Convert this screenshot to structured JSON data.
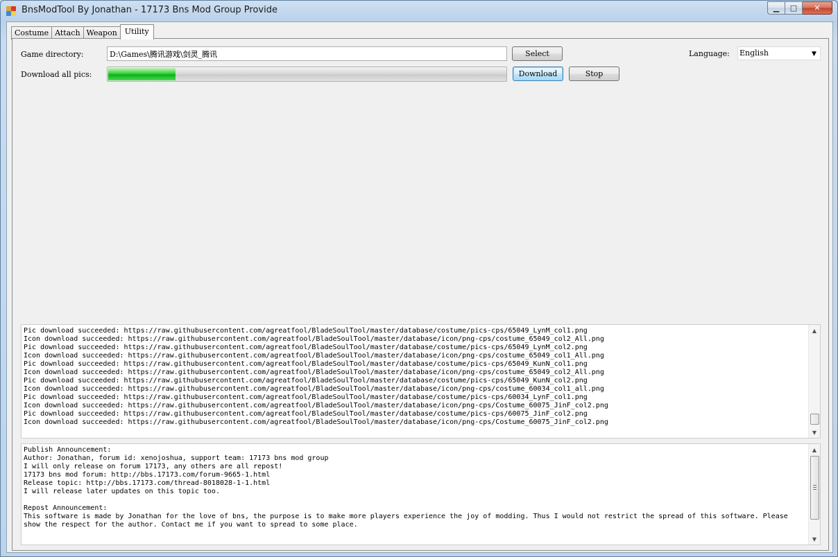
{
  "window": {
    "title": "BnsModTool By Jonathan - 17173 Bns Mod Group Provide",
    "min_glyph": "▁",
    "max_glyph": "□",
    "close_glyph": "✕"
  },
  "tabs": [
    {
      "label": "Costume",
      "active": false
    },
    {
      "label": "Attach",
      "active": false
    },
    {
      "label": "Weapon",
      "active": false
    },
    {
      "label": "Utility",
      "active": true
    }
  ],
  "utility": {
    "game_dir_label": "Game directory:",
    "game_dir_value": "D:\\Games\\腾讯游戏\\剑灵_腾讯",
    "select_button": "Select",
    "download_label": "Download all pics:",
    "progress_percent": 17,
    "download_button": "Download",
    "stop_button": "Stop",
    "language_label": "Language:",
    "language_value": "English",
    "dropdown_glyph": "▼"
  },
  "log": {
    "up_glyph": "▲",
    "down_glyph": "▼",
    "lines": [
      "Pic download succeeded: https://raw.githubusercontent.com/agreatfool/BladeSoulTool/master/database/costume/pics-cps/65049_LynM_col1.png",
      "Icon download succeeded: https://raw.githubusercontent.com/agreatfool/BladeSoulTool/master/database/icon/png-cps/costume_65049_col2_All.png",
      "Pic download succeeded: https://raw.githubusercontent.com/agreatfool/BladeSoulTool/master/database/costume/pics-cps/65049_LynM_col2.png",
      "Icon download succeeded: https://raw.githubusercontent.com/agreatfool/BladeSoulTool/master/database/icon/png-cps/costume_65049_col1_All.png",
      "Pic download succeeded: https://raw.githubusercontent.com/agreatfool/BladeSoulTool/master/database/costume/pics-cps/65049_KunN_col1.png",
      "Icon download succeeded: https://raw.githubusercontent.com/agreatfool/BladeSoulTool/master/database/icon/png-cps/costume_65049_col2_All.png",
      "Pic download succeeded: https://raw.githubusercontent.com/agreatfool/BladeSoulTool/master/database/costume/pics-cps/65049_KunN_col2.png",
      "Icon download succeeded: https://raw.githubusercontent.com/agreatfool/BladeSoulTool/master/database/icon/png-cps/costume_60034_col1_all.png",
      "Pic download succeeded: https://raw.githubusercontent.com/agreatfool/BladeSoulTool/master/database/costume/pics-cps/60034_LynF_col1.png",
      "Icon download succeeded: https://raw.githubusercontent.com/agreatfool/BladeSoulTool/master/database/icon/png-cps/Costume_60075_JinF_col2.png",
      "Pic download succeeded: https://raw.githubusercontent.com/agreatfool/BladeSoulTool/master/database/costume/pics-cps/60075_JinF_col2.png",
      "Icon download succeeded: https://raw.githubusercontent.com/agreatfool/BladeSoulTool/master/database/icon/png-cps/Costume_60075_JinF_col2.png"
    ]
  },
  "announcement": {
    "grip_glyph": "≡",
    "lines": [
      "Publish Announcement:",
      "Author: Jonathan, forum id: xenojoshua, support team: 17173 bns mod group",
      "I will only release on forum 17173, any others are all repost!",
      "17173 bns mod forum: http://bbs.17173.com/forum-9665-1.html",
      "Release topic: http://bbs.17173.com/thread-8018028-1-1.html",
      "I will release later updates on this topic too.",
      "",
      "Repost Announcement:",
      "This software is made by Jonathan for the love of bns, the purpose is to make more players experience the joy of modding. Thus I would not restrict the spread of this software. Please show the respect for the author. Contact me if you want to spread to some place."
    ]
  }
}
